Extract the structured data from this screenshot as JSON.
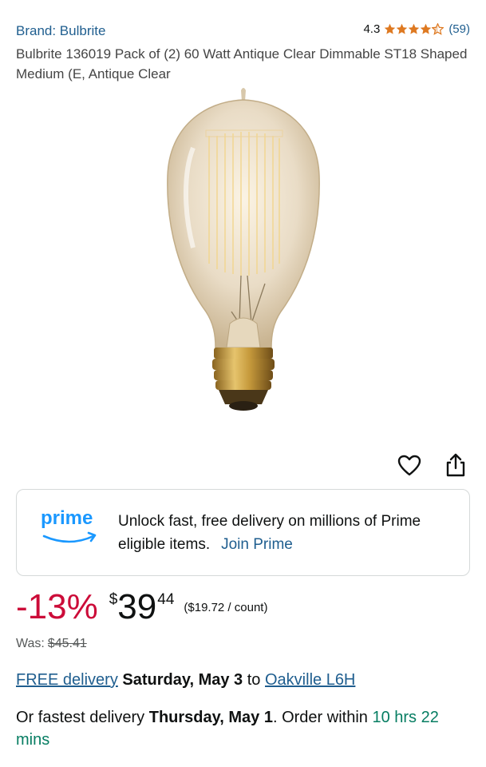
{
  "product": {
    "brand_label": "Brand: Bulbrite",
    "title": "Bulbrite 136019 Pack of (2) 60 Watt Antique Clear Dimmable ST18 Shaped Medium (E, Antique Clear",
    "rating_value": "4.3",
    "rating_stars": 4.3,
    "rating_count": "(59)",
    "image_icon": "edison-bulb-image"
  },
  "actions": {
    "wishlist_icon": "heart-icon",
    "share_icon": "share-icon"
  },
  "prime": {
    "logo_text": "prime",
    "message": "Unlock fast, free delivery on millions of Prime eligible items.",
    "join_label": "Join Prime",
    "brand_color": "#1a98ff"
  },
  "pricing": {
    "discount": "-13%",
    "currency_symbol": "$",
    "whole": "39",
    "fraction": "44",
    "unit_price": "($19.72 / count)",
    "was_label": "Was:",
    "was_price": "$45.41",
    "discount_color": "#cc0c39"
  },
  "delivery": {
    "free_label": "FREE delivery",
    "date": "Saturday, May 3",
    "to": "to",
    "location": "Oakville L6H",
    "fastest_prefix": "Or fastest delivery",
    "fastest_date": "Thursday, May 1",
    "order_within": ". Order within",
    "countdown": "10 hrs 22 mins"
  }
}
